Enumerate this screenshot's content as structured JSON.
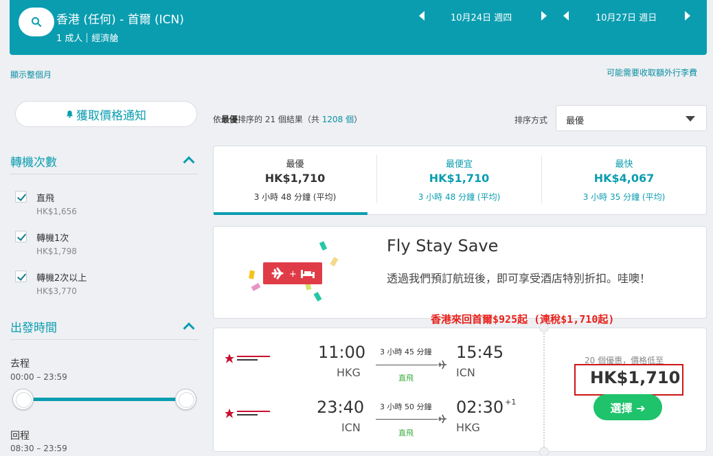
{
  "search": {
    "route": "香港 (任何) - 首爾 (ICN)",
    "passengers": "1 成人",
    "cabin": "經濟艙",
    "depart_date": "10月24日 週四",
    "return_date": "10月27日 週日"
  },
  "links": {
    "show_month": "顯示整個月",
    "baggage_fee": "可能需要收取額外行李費"
  },
  "sidebar": {
    "price_alert": "獲取價格通知",
    "stops_title": "轉機次數",
    "stops": [
      {
        "label": "直飛",
        "price": "HK$1,656"
      },
      {
        "label": "轉機1次",
        "price": "HK$1,798"
      },
      {
        "label": "轉機2次以上",
        "price": "HK$3,770"
      }
    ],
    "departure_title": "出發時間",
    "outbound_label": "去程",
    "outbound_range": "00:00 – 23:59",
    "return_label": "回程",
    "return_range": "08:30 – 23:59"
  },
  "results": {
    "prefix": "依",
    "sort_word": "最優",
    "middle": "排序的 21 個結果（共 ",
    "total": "1208 個",
    "suffix": "）",
    "sort_label": "排序方式",
    "sort_value": "最優"
  },
  "tabs": [
    {
      "title": "最優",
      "price": "HK$1,710",
      "duration": "3 小時 48 分鐘 (平均)"
    },
    {
      "title": "最便宜",
      "price": "HK$1,710",
      "duration": "3 小時 48 分鐘 (平均)"
    },
    {
      "title": "最快",
      "price": "HK$4,067",
      "duration": "3 小時 35 分鐘 (平均)"
    }
  ],
  "promo": {
    "title": "Fly Stay Save",
    "text": "透過我們預訂航班後，即可享受酒店特別折扣。哇噢！"
  },
  "annotation": "香港來回首爾$925起 (連稅$1,710起)",
  "flight": {
    "outbound": {
      "depart": "11:00",
      "arrive": "15:45",
      "from": "HKG",
      "to": "ICN",
      "duration": "3 小時 45 分鐘",
      "stops": "直飛"
    },
    "return": {
      "depart": "23:40",
      "arrive": "02:30",
      "arrive_plus": "+1",
      "from": "ICN",
      "to": "HKG",
      "duration": "3 小時 50 分鐘",
      "stops": "直飛"
    },
    "deals": "20 個優惠，價格低至",
    "price": "HK$1,710",
    "select": "選擇 ➔"
  },
  "colors": {
    "brand": "#0a9db0",
    "accent_red": "#e03c47",
    "select_green": "#1ec36b",
    "annotation_red": "#e8201a"
  }
}
